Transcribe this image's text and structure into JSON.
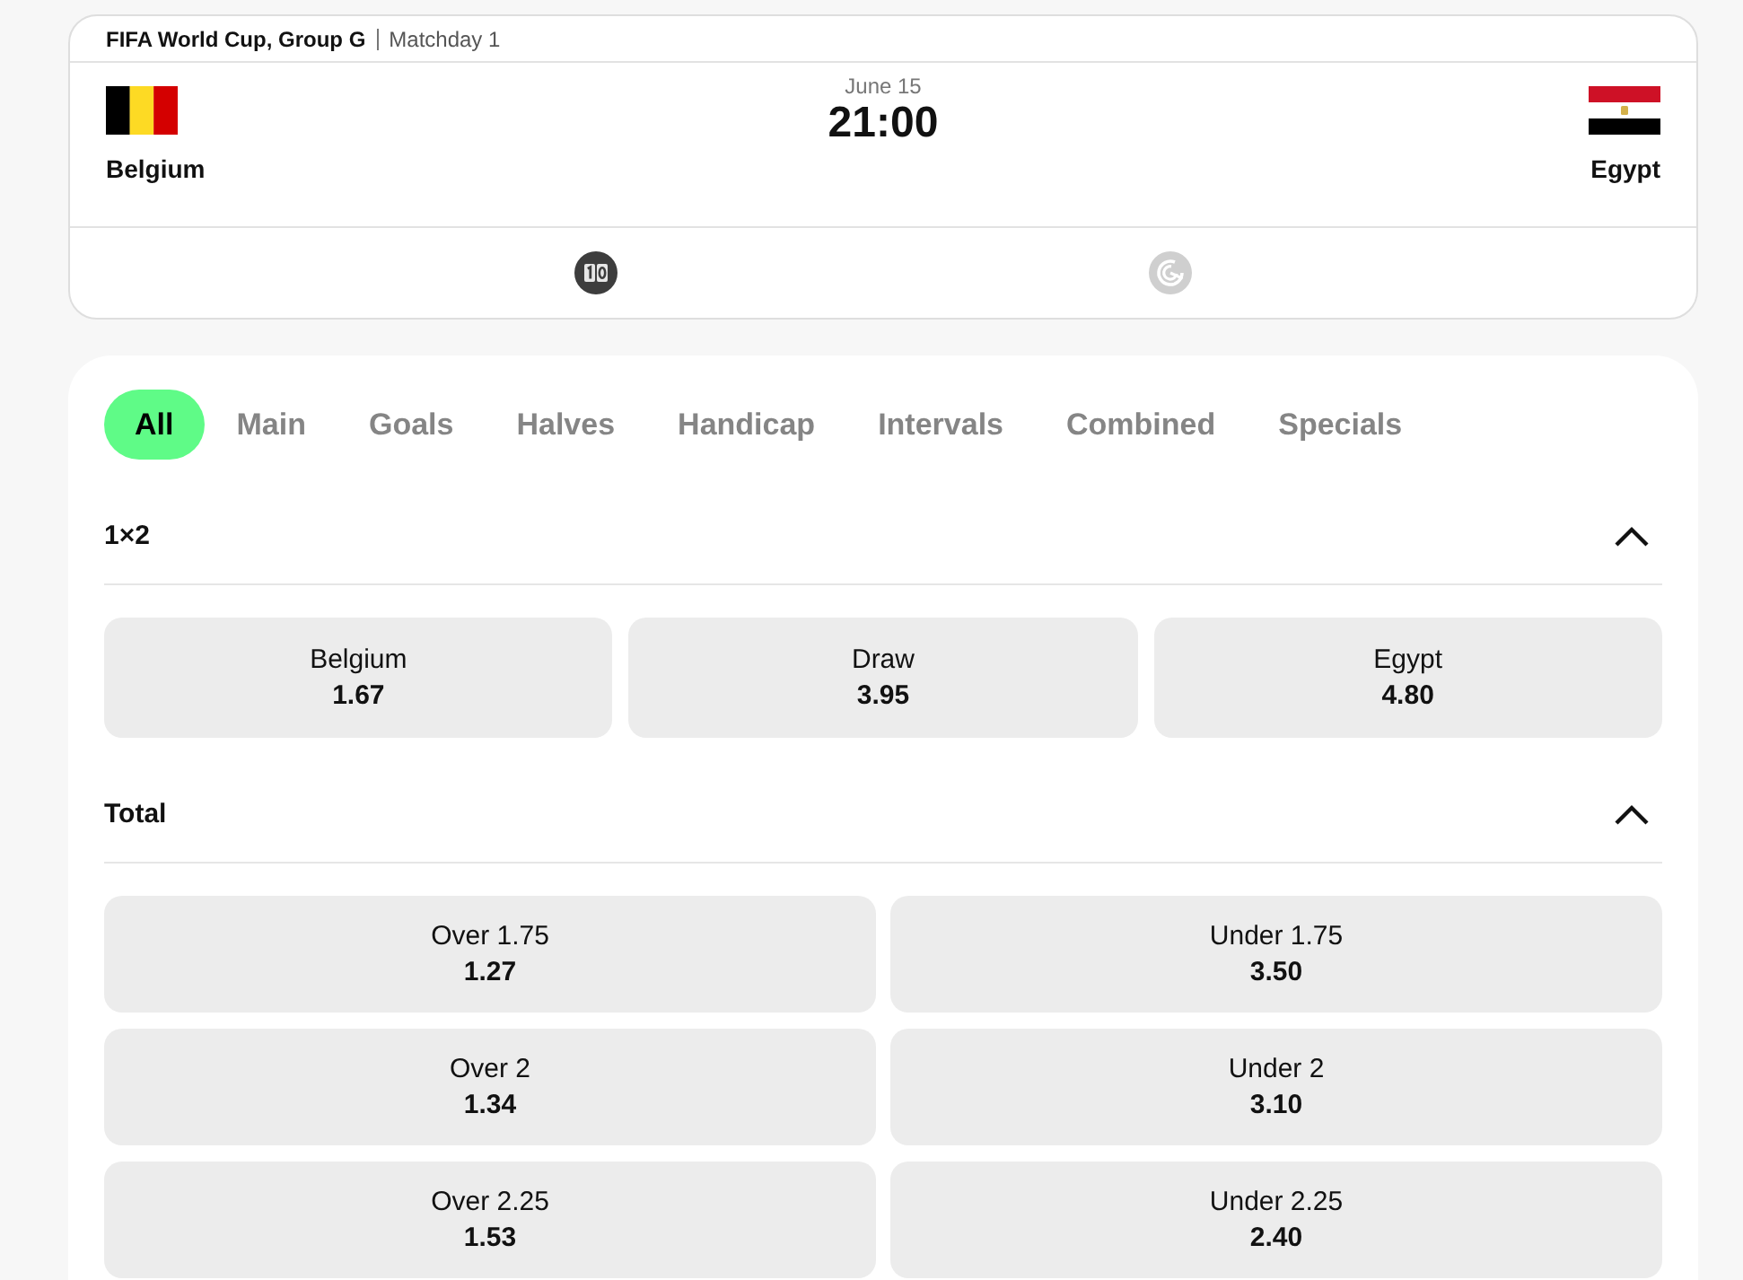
{
  "header": {
    "competition": "FIFA World Cup, Group G",
    "matchday": "Matchday 1"
  },
  "match": {
    "teams": [
      {
        "name": "Belgium"
      },
      {
        "name": "Egypt"
      }
    ],
    "date": "June 15",
    "time": "21:00"
  },
  "match_tools": [
    {
      "kind": "scoreboard",
      "selected": true
    },
    {
      "kind": "spiral",
      "selected": false
    }
  ],
  "tabs": [
    {
      "label": "All",
      "selected": true
    },
    {
      "label": "Main",
      "selected": false
    },
    {
      "label": "Goals",
      "selected": false
    },
    {
      "label": "Halves",
      "selected": false
    },
    {
      "label": "Handicap",
      "selected": false
    },
    {
      "label": "Intervals",
      "selected": false
    },
    {
      "label": "Combined",
      "selected": false
    },
    {
      "label": "Specials",
      "selected": false
    }
  ],
  "markets": [
    {
      "kind": "three_way",
      "title": "1×2",
      "expanded": true,
      "outcomes": [
        {
          "label": "Belgium",
          "odds": "1.67"
        },
        {
          "label": "Draw",
          "odds": "3.95"
        },
        {
          "label": "Egypt",
          "odds": "4.80"
        }
      ]
    },
    {
      "kind": "over_under",
      "title": "Total",
      "expanded": true,
      "outcomes": [
        {
          "label": "Over 1.75",
          "odds": "1.27"
        },
        {
          "label": "Under 1.75",
          "odds": "3.50"
        },
        {
          "label": "Over 2",
          "odds": "1.34"
        },
        {
          "label": "Under 2",
          "odds": "3.10"
        },
        {
          "label": "Over 2.25",
          "odds": "1.53"
        },
        {
          "label": "Under 2.25",
          "odds": "2.40"
        }
      ]
    }
  ]
}
